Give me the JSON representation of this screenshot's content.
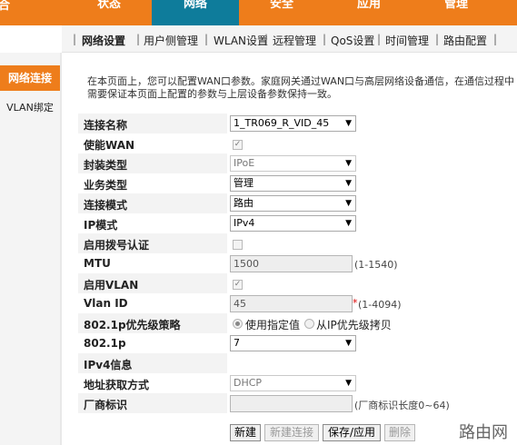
{
  "brand": "合",
  "tabs": [
    {
      "label": "状态",
      "active": false
    },
    {
      "label": "网络",
      "active": true
    },
    {
      "label": "安全",
      "active": false
    },
    {
      "label": "应用",
      "active": false
    },
    {
      "label": "管理",
      "active": false
    }
  ],
  "subnav": [
    {
      "label": "网络设置",
      "active": true
    },
    {
      "label": "用户侧管理",
      "active": false
    },
    {
      "label": "WLAN设置",
      "active": false
    },
    {
      "label": "远程管理",
      "active": false
    },
    {
      "label": "QoS设置",
      "active": false
    },
    {
      "label": "时间管理",
      "active": false
    },
    {
      "label": "路由配置",
      "active": false
    }
  ],
  "subnav_separator": "|",
  "sidebar": {
    "items": [
      {
        "label": "网络连接",
        "active": true
      },
      {
        "label": "VLAN绑定",
        "active": false
      }
    ]
  },
  "intro": "在本页面上，您可以配置WAN口参数。家庭网关通过WAN口与高层网络设备通信，在通信过程中需要保证本页面上配置的参数与上层设备参数保持一致。",
  "form": {
    "connection_name": {
      "label": "连接名称",
      "value": "1_TR069_R_VID_45"
    },
    "enable_wan": {
      "label": "使能WAN",
      "checked": true
    },
    "encap_type": {
      "label": "封装类型",
      "value": "IPoE"
    },
    "service_type": {
      "label": "业务类型",
      "value": "管理"
    },
    "conn_mode": {
      "label": "连接模式",
      "value": "路由"
    },
    "ip_mode": {
      "label": "IP模式",
      "value": "IPv4"
    },
    "dial_auth": {
      "label": "启用拨号认证",
      "checked": false
    },
    "mtu": {
      "label": "MTU",
      "value": "1500",
      "hint": "(1-1540)"
    },
    "enable_vlan": {
      "label": "启用VLAN",
      "checked": true
    },
    "vlan_id": {
      "label": "Vlan ID",
      "value": "45",
      "required_mark": "*",
      "hint": "(1-4094)"
    },
    "priority_policy": {
      "label": "802.1p优先级策略",
      "option_a": "使用指定值",
      "option_b": "从IP优先级拷贝",
      "selected": "option_a"
    },
    "dot1p": {
      "label": "802.1p",
      "value": "7"
    },
    "ipv4_info": {
      "label": "IPv4信息"
    },
    "addr_method": {
      "label": "地址获取方式",
      "value": "DHCP"
    },
    "vendor_id": {
      "label": "厂商标识",
      "value": "",
      "hint": "(厂商标识长度0~64)"
    }
  },
  "buttons": {
    "new": "新建",
    "new_conn": "新建连接",
    "save_apply": "保存/应用",
    "delete": "删除"
  },
  "watermark": "路由网",
  "colors": {
    "accent": "#ee7d1b",
    "active_tab": "#0e7c9b"
  }
}
